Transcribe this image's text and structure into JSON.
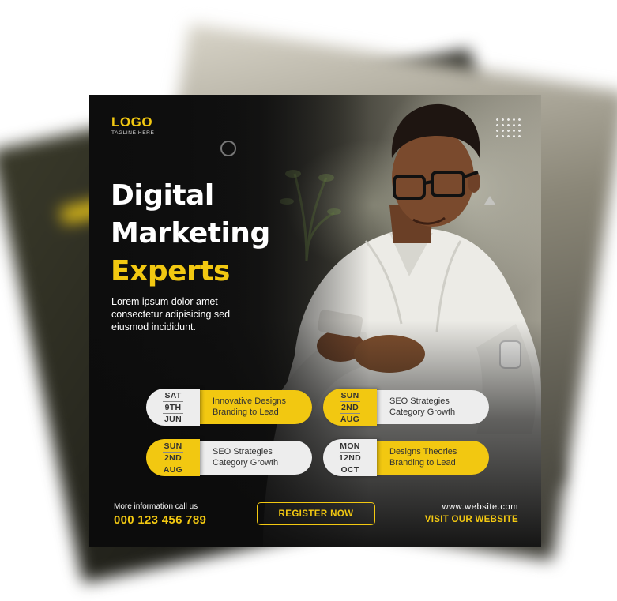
{
  "brand": {
    "logo": "LOGO",
    "tagline": "TAGLINE HERE",
    "accent_color": "#f2c811"
  },
  "headline": {
    "line1": "Digital",
    "line2": "Marketing",
    "line3": "Experts"
  },
  "description": {
    "line1": "Lorem ipsum dolor amet",
    "line2": "consectetur adipisicing sed",
    "line3": "eiusmod incididunt."
  },
  "events": [
    {
      "day": "SAT",
      "date": "9TH",
      "month": "JUN",
      "title": "Innovative Designs",
      "subtitle": "Branding to Lead"
    },
    {
      "day": "SUN",
      "date": "2ND",
      "month": "AUG",
      "title": "SEO Strategies",
      "subtitle": "Category Growth"
    },
    {
      "day": "SUN",
      "date": "2ND",
      "month": "AUG",
      "title": "SEO Strategies",
      "subtitle": "Category Growth"
    },
    {
      "day": "MON",
      "date": "12ND",
      "month": "OCT",
      "title": "Designs Theories",
      "subtitle": "Branding to Lead"
    }
  ],
  "footer": {
    "info_label": "More information call us",
    "phone": "000 123 456 789",
    "register_label": "REGISTER NOW",
    "website": "www.website.com",
    "visit_label": "VISIT OUR WEBSITE"
  }
}
